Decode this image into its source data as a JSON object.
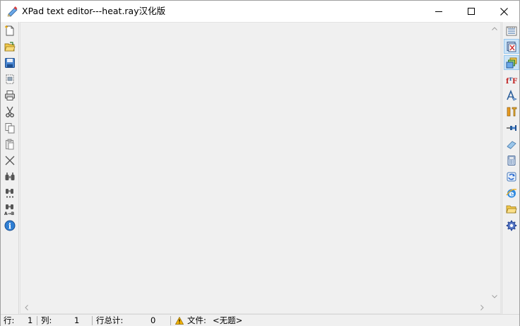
{
  "window": {
    "title": "XPad text editor---heat.ray汉化版"
  },
  "left_toolbar": [
    {
      "name": "new-file-icon"
    },
    {
      "name": "open-file-icon"
    },
    {
      "name": "save-icon"
    },
    {
      "name": "print-preview-icon"
    },
    {
      "name": "print-icon"
    },
    {
      "name": "cut-icon"
    },
    {
      "name": "copy-icon"
    },
    {
      "name": "paste-icon"
    },
    {
      "name": "delete-icon"
    },
    {
      "name": "find-icon"
    },
    {
      "name": "find-next-icon"
    },
    {
      "name": "replace-icon"
    },
    {
      "name": "about-info-icon"
    }
  ],
  "right_toolbar": [
    {
      "name": "toolbar-options-icon"
    },
    {
      "name": "always-on-top-icon",
      "active": true
    },
    {
      "name": "cascade-windows-icon",
      "active": true
    },
    {
      "name": "font-icon"
    },
    {
      "name": "text-style-icon"
    },
    {
      "name": "tools-icon"
    },
    {
      "name": "pin-icon"
    },
    {
      "name": "eraser-icon"
    },
    {
      "name": "calculator-icon"
    },
    {
      "name": "refresh-icon"
    },
    {
      "name": "internet-explorer-icon"
    },
    {
      "name": "open-folder-icon"
    },
    {
      "name": "settings-gear-icon"
    }
  ],
  "editor": {
    "content": ""
  },
  "statusbar": {
    "line_label": "行:",
    "line_value": "1",
    "col_label": "列:",
    "col_value": "1",
    "total_label": "行总计:",
    "total_value": "0",
    "file_label": "文件:",
    "file_value": "<无题>"
  },
  "colors": {
    "accent": "#0078d7",
    "active_button_bg": "#cce4f7",
    "warning": "#f5b400"
  }
}
